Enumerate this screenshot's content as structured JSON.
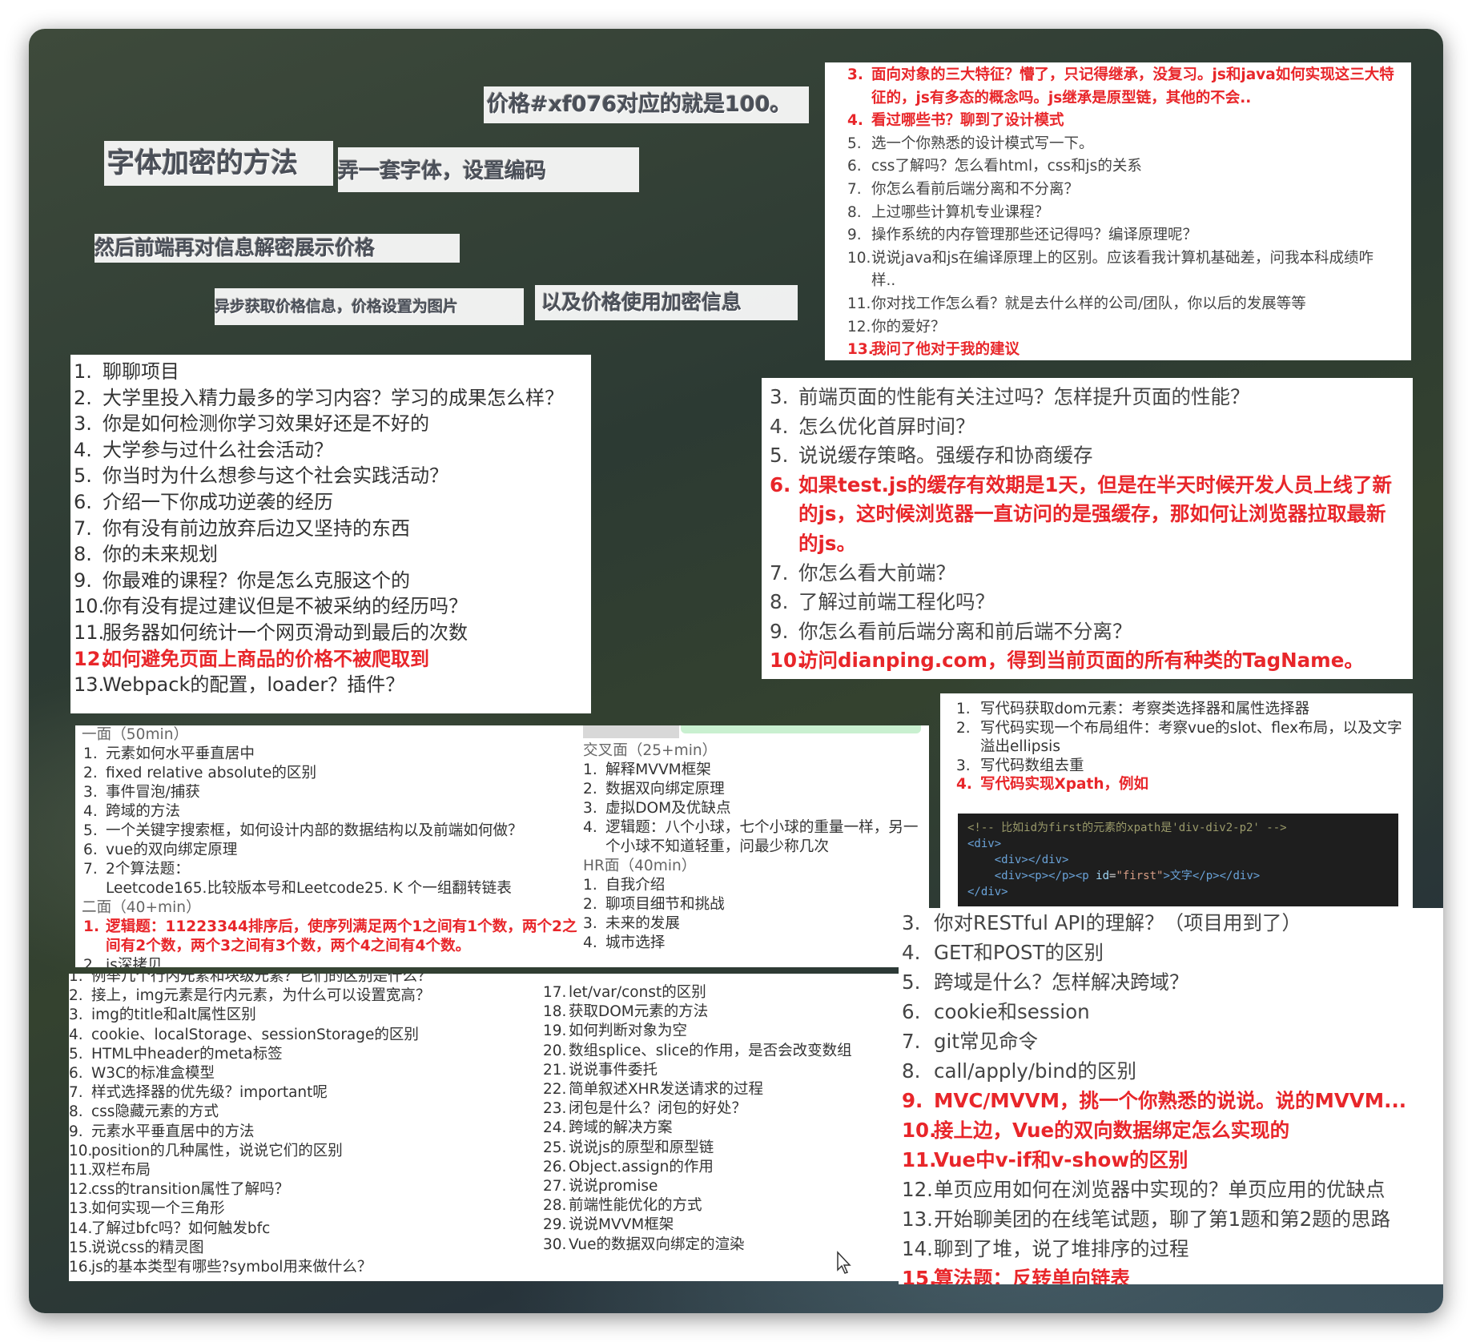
{
  "captions": [
    {
      "text": "价格#xf076对应的就是100。"
    },
    {
      "text": "字体加密的方法"
    },
    {
      "text": "弄一套字体，设置编码"
    },
    {
      "text": "然后前端再对信息解密展示价格"
    },
    {
      "text": "异步获取价格信息，价格设置为图片"
    },
    {
      "text": "以及价格使用加密信息"
    }
  ],
  "card_top_right": {
    "items": [
      {
        "n": "3.",
        "text": "面向对象的三大特征？懵了，只记得继承，没复习。js和java如何实现这三大特征的，js有多态的概念吗。js继承是原型链，其他的不会..",
        "red": true
      },
      {
        "n": "4.",
        "text": "看过哪些书？聊到了设计模式",
        "red": true
      },
      {
        "n": "5.",
        "text": "选一个你熟悉的设计模式写一下。"
      },
      {
        "n": "6.",
        "text": "css了解吗？怎么看html，css和js的关系"
      },
      {
        "n": "7.",
        "text": "你怎么看前后端分离和不分离？"
      },
      {
        "n": "8.",
        "text": "上过哪些计算机专业课程？"
      },
      {
        "n": "9.",
        "text": "操作系统的内存管理那些还记得吗？编译原理呢？"
      },
      {
        "n": "10.",
        "text": "说说java和js在编译原理上的区别。应该看我计算机基础差，问我本科成绩咋样.."
      },
      {
        "n": "11.",
        "text": "你对找工作怎么看？就是去什么样的公司/团队，你以后的发展等等"
      },
      {
        "n": "12.",
        "text": "你的爱好？"
      },
      {
        "n": "13.",
        "text": "我问了他对于我的建议",
        "red": true
      }
    ]
  },
  "card_left_big": {
    "items": [
      {
        "n": "1.",
        "text": "聊聊项目"
      },
      {
        "n": "2.",
        "text": "大学里投入精力最多的学习内容？学习的成果怎么样？"
      },
      {
        "n": "3.",
        "text": "你是如何检测你学习效果好还是不好的"
      },
      {
        "n": "4.",
        "text": "大学参与过什么社会活动？"
      },
      {
        "n": "5.",
        "text": "你当时为什么想参与这个社会实践活动？"
      },
      {
        "n": "6.",
        "text": "介绍一下你成功逆袭的经历"
      },
      {
        "n": "7.",
        "text": "你有没有前边放弃后边又坚持的东西"
      },
      {
        "n": "8.",
        "text": "你的未来规划"
      },
      {
        "n": "9.",
        "text": "你最难的课程？你是怎么克服这个的"
      },
      {
        "n": "10.",
        "text": "你有没有提过建议但是不被采纳的经历吗？"
      },
      {
        "n": "11.",
        "text": "服务器如何统计一个网页滑动到最后的次数"
      },
      {
        "n": "12.",
        "text": "如何避免页面上商品的价格不被爬取到",
        "red": true
      },
      {
        "n": "13.",
        "text": "Webpack的配置，loader？插件？"
      }
    ]
  },
  "card_mid_right": {
    "items": [
      {
        "n": "3.",
        "text": "前端页面的性能有关注过吗？怎样提升页面的性能？"
      },
      {
        "n": "4.",
        "text": "怎么优化首屏时间？"
      },
      {
        "n": "5.",
        "text": "说说缓存策略。强缓存和协商缓存"
      },
      {
        "n": "6.",
        "text": "如果test.js的缓存有效期是1天，但是在半天时候开发人员上线了新的js，这时候浏览器一直访问的是强缓存，那如何让浏览器拉取最新的js。",
        "red": true
      },
      {
        "n": "7.",
        "text": "你怎么看大前端？"
      },
      {
        "n": "8.",
        "text": "了解过前端工程化吗？"
      },
      {
        "n": "9.",
        "text": "你怎么看前后端分离和前后端不分离？"
      },
      {
        "n": "10.",
        "text": "访问dianping.com，得到当前页面的所有种类的TagName。",
        "red": true
      }
    ]
  },
  "card_interview": {
    "round1_title": "一面（50min）",
    "round1": [
      {
        "n": "1.",
        "text": "元素如何水平垂直居中"
      },
      {
        "n": "2.",
        "text": "fixed relative absolute的区别"
      },
      {
        "n": "3.",
        "text": "事件冒泡/捕获"
      },
      {
        "n": "4.",
        "text": "跨域的方法"
      },
      {
        "n": "5.",
        "text": "一个关键字搜索框，如何设计内部的数据结构以及前端如何做？"
      },
      {
        "n": "6.",
        "text": "vue的双向绑定原理"
      },
      {
        "n": "7.",
        "text": "2个算法题："
      },
      {
        "n": "",
        "text": "Leetcode165.比较版本号和Leetcode25. K 个一组翻转链表"
      }
    ],
    "round2_title": "二面（40+min）",
    "round2": [
      {
        "n": "1.",
        "text": "逻辑题：11223344排序后，使序列满足两个1之间有1个数，两个2之间有2个数，两个3之间有3个数，两个4之间有4个数。",
        "red": true
      },
      {
        "n": "2.",
        "text": "js深拷贝"
      }
    ],
    "cross_title": "交叉面（25+min）",
    "cross": [
      {
        "n": "1.",
        "text": "解释MVVM框架"
      },
      {
        "n": "2.",
        "text": "数据双向绑定原理"
      },
      {
        "n": "3.",
        "text": "虚拟DOM及优缺点"
      },
      {
        "n": "4.",
        "text": "逻辑题：八个小球，七个小球的重量一样，另一个小球不知道轻重，问最少称几次"
      }
    ],
    "hr_title": "HR面（40min）",
    "hr": [
      {
        "n": "1.",
        "text": "自我介绍"
      },
      {
        "n": "2.",
        "text": "聊项目细节和挑战"
      },
      {
        "n": "3.",
        "text": "未来的发展"
      },
      {
        "n": "4.",
        "text": "城市选择"
      }
    ]
  },
  "card_xpath": {
    "items": [
      {
        "n": "1.",
        "text": "写代码获取dom元素：考察类选择器和属性选择器"
      },
      {
        "n": "2.",
        "text": "写代码实现一个布局组件：考察vue的slot、flex布局，以及文字溢出ellipsis"
      },
      {
        "n": "3.",
        "text": "写代码数组去重"
      },
      {
        "n": "4.",
        "text": "写代码实现Xpath，例如",
        "red": true
      }
    ],
    "code_comment": "<!-- 比如id为first的元素的xpath是'div-div2-p2' -->",
    "code_line2": "<div>",
    "code_line3": "<div></div>",
    "code_line4_a": "<div><p></p><p ",
    "code_line4_attr": "id",
    "code_line4_eq": "=",
    "code_line4_val": "\"first\"",
    "code_line4_b": ">文字</p></div>",
    "code_line5": "</div>"
  },
  "card_bottom_left": {
    "col1": [
      {
        "n": "1.",
        "text": "例举几个行内元素和块级元素？它们的区别是什么？"
      },
      {
        "n": "2.",
        "text": "接上，img元素是行内元素，为什么可以设置宽高？"
      },
      {
        "n": "3.",
        "text": "img的title和alt属性区别"
      },
      {
        "n": "4.",
        "text": "cookie、localStorage、sessionStorage的区别"
      },
      {
        "n": "5.",
        "text": "HTML中header的meta标签"
      },
      {
        "n": "6.",
        "text": "W3C的标准盒模型"
      },
      {
        "n": "7.",
        "text": "样式选择器的优先级？important呢"
      },
      {
        "n": "8.",
        "text": "css隐藏元素的方式"
      },
      {
        "n": "9.",
        "text": "元素水平垂直居中的方法"
      },
      {
        "n": "10.",
        "text": "position的几种属性，说说它们的区别"
      },
      {
        "n": "11.",
        "text": "双栏布局"
      },
      {
        "n": "12.",
        "text": "css的transition属性了解吗？"
      },
      {
        "n": "13.",
        "text": "如何实现一个三角形"
      },
      {
        "n": "14.",
        "text": "了解过bfc吗？如何触发bfc"
      },
      {
        "n": "15.",
        "text": "说说css的精灵图"
      },
      {
        "n": "16.",
        "text": "js的基本类型有哪些?symbol用来做什么？"
      }
    ],
    "col2": [
      {
        "n": "17.",
        "text": "let/var/const的区别"
      },
      {
        "n": "18.",
        "text": "获取DOM元素的方法"
      },
      {
        "n": "19.",
        "text": "如何判断对象为空"
      },
      {
        "n": "20.",
        "text": "数组splice、slice的作用，是否会改变数组"
      },
      {
        "n": "21.",
        "text": "说说事件委托"
      },
      {
        "n": "22.",
        "text": "简单叙述XHR发送请求的过程"
      },
      {
        "n": "23.",
        "text": "闭包是什么？闭包的好处？"
      },
      {
        "n": "24.",
        "text": "跨域的解决方案"
      },
      {
        "n": "25.",
        "text": "说说js的原型和原型链"
      },
      {
        "n": "26.",
        "text": "Object.assign的作用"
      },
      {
        "n": "27.",
        "text": "说说promise"
      },
      {
        "n": "28.",
        "text": "前端性能优化的方式"
      },
      {
        "n": "29.",
        "text": "说说MVVM框架"
      },
      {
        "n": "30.",
        "text": "Vue的数据双向绑定的渲染"
      }
    ]
  },
  "card_bottom_right": {
    "items": [
      {
        "n": "3.",
        "text": "你对RESTful API的理解？（项目用到了）"
      },
      {
        "n": "4.",
        "text": "GET和POST的区别"
      },
      {
        "n": "5.",
        "text": "跨域是什么？怎样解决跨域？"
      },
      {
        "n": "6.",
        "text": "cookie和session"
      },
      {
        "n": "7.",
        "text": "git常见命令"
      },
      {
        "n": "8.",
        "text": "call/apply/bind的区别"
      },
      {
        "n": "9.",
        "text": "MVC/MVVM，挑一个你熟悉的说说。说的MVVM...",
        "red": true
      },
      {
        "n": "10.",
        "text": "接上边，Vue的双向数据绑定怎么实现的",
        "red": true
      },
      {
        "n": "11.",
        "text": "Vue中v-if和v-show的区别",
        "red": true
      },
      {
        "n": "12.",
        "text": "单页应用如何在浏览器中实现的？单页应用的优缺点"
      },
      {
        "n": "13.",
        "text": "开始聊美团的在线笔试题，聊了第1题和第2题的思路"
      },
      {
        "n": "14.",
        "text": "聊到了堆，说了堆排序的过程"
      },
      {
        "n": "15.",
        "text": "算法题：反转单向链表",
        "red": true
      }
    ]
  },
  "colors": {
    "red": "#e8262a",
    "text": "#333333",
    "gray": "#666666"
  }
}
